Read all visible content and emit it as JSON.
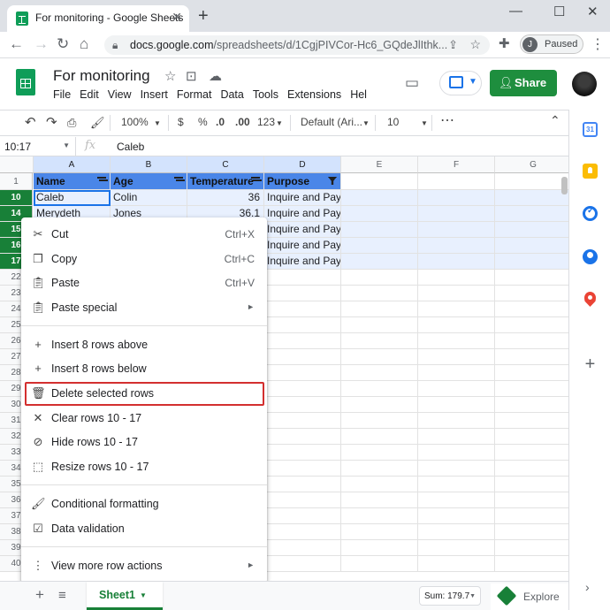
{
  "browser": {
    "tab_title": "For monitoring - Google Sheets",
    "tab_close": "✕",
    "new_tab": "+",
    "window_controls": [
      "—",
      "☐",
      "✕"
    ],
    "url_host": "docs.google.com",
    "url_path": "/spreadsheets/d/1CgjPIVCor-Hc6_GQdeJlIthk...",
    "profile_initial": "J",
    "profile_status": "Paused"
  },
  "app": {
    "doc_title": "For monitoring",
    "menus": [
      "File",
      "Edit",
      "View",
      "Insert",
      "Format",
      "Data",
      "Tools",
      "Extensions",
      "Hel"
    ],
    "share_label": "Share",
    "brand_color": "#188038",
    "share_color": "#1e8e3e"
  },
  "toolbar": {
    "zoom": "100%",
    "currency": "$",
    "percent": "%",
    "dec_less": ".0",
    "dec_more": ".00",
    "more_formats": "123",
    "font": "Default (Ari...",
    "font_size": "10"
  },
  "formula_bar": {
    "name_box": "10:17",
    "fx": "fx",
    "value": "Caleb"
  },
  "grid": {
    "columns": [
      "A",
      "B",
      "C",
      "D",
      "E",
      "F",
      "G"
    ],
    "header_row_number": "1",
    "header_cells": [
      "Name",
      "Age",
      "Temperature",
      "Purpose"
    ],
    "header_color": "#4a86e8",
    "selected_rows": [
      {
        "num": "10",
        "cells": [
          "Caleb",
          "Colin",
          "36",
          "Inquire and Pay"
        ]
      },
      {
        "num": "14",
        "cells": [
          "Merydeth",
          "Jones",
          "36.1",
          "Inquire and Pay"
        ]
      },
      {
        "num": "15",
        "cells": [
          "",
          "",
          "",
          "Inquire and Pay"
        ]
      },
      {
        "num": "16",
        "cells": [
          "",
          "",
          "",
          "Inquire and Pay"
        ]
      },
      {
        "num": "17",
        "cells": [
          "",
          "",
          "",
          "Inquire and Pay"
        ]
      }
    ],
    "other_rows": [
      "22",
      "23",
      "24",
      "25",
      "26",
      "27",
      "28",
      "29",
      "30",
      "31",
      "32",
      "33",
      "34",
      "35",
      "36",
      "37",
      "38",
      "39",
      "40"
    ]
  },
  "context_menu": {
    "items": [
      {
        "icon": "scissors-icon",
        "label": "Cut",
        "shortcut": "Ctrl+X"
      },
      {
        "icon": "copy-icon",
        "label": "Copy",
        "shortcut": "Ctrl+C"
      },
      {
        "icon": "clipboard-icon",
        "label": "Paste",
        "shortcut": "Ctrl+V"
      },
      {
        "icon": "clipboard-icon",
        "label": "Paste special",
        "submenu": "►"
      },
      {
        "icon": "plus-icon",
        "label": "Insert 8 rows above"
      },
      {
        "icon": "plus-icon",
        "label": "Insert 8 rows below"
      },
      {
        "icon": "trash-icon",
        "label": "Delete selected rows"
      },
      {
        "icon": "close-icon",
        "label": "Clear rows 10 - 17"
      },
      {
        "icon": "eye-off-icon",
        "label": "Hide rows 10 - 17"
      },
      {
        "icon": "resize-icon",
        "label": "Resize rows 10 - 17"
      },
      {
        "icon": "paint-roller-icon",
        "label": "Conditional formatting"
      },
      {
        "icon": "data-validation-icon",
        "label": "Data validation"
      },
      {
        "icon": "more-vert-icon",
        "label": "View more row actions",
        "submenu": "►"
      }
    ],
    "highlight_color": "#d32f2f"
  },
  "bottom_bar": {
    "add_sheet": "+",
    "sheet_name": "Sheet1",
    "sum": "Sum: 179.7",
    "explore": "Explore"
  },
  "side_panel": {
    "calendar_day": "31",
    "add": "+",
    "collapse": "›"
  }
}
